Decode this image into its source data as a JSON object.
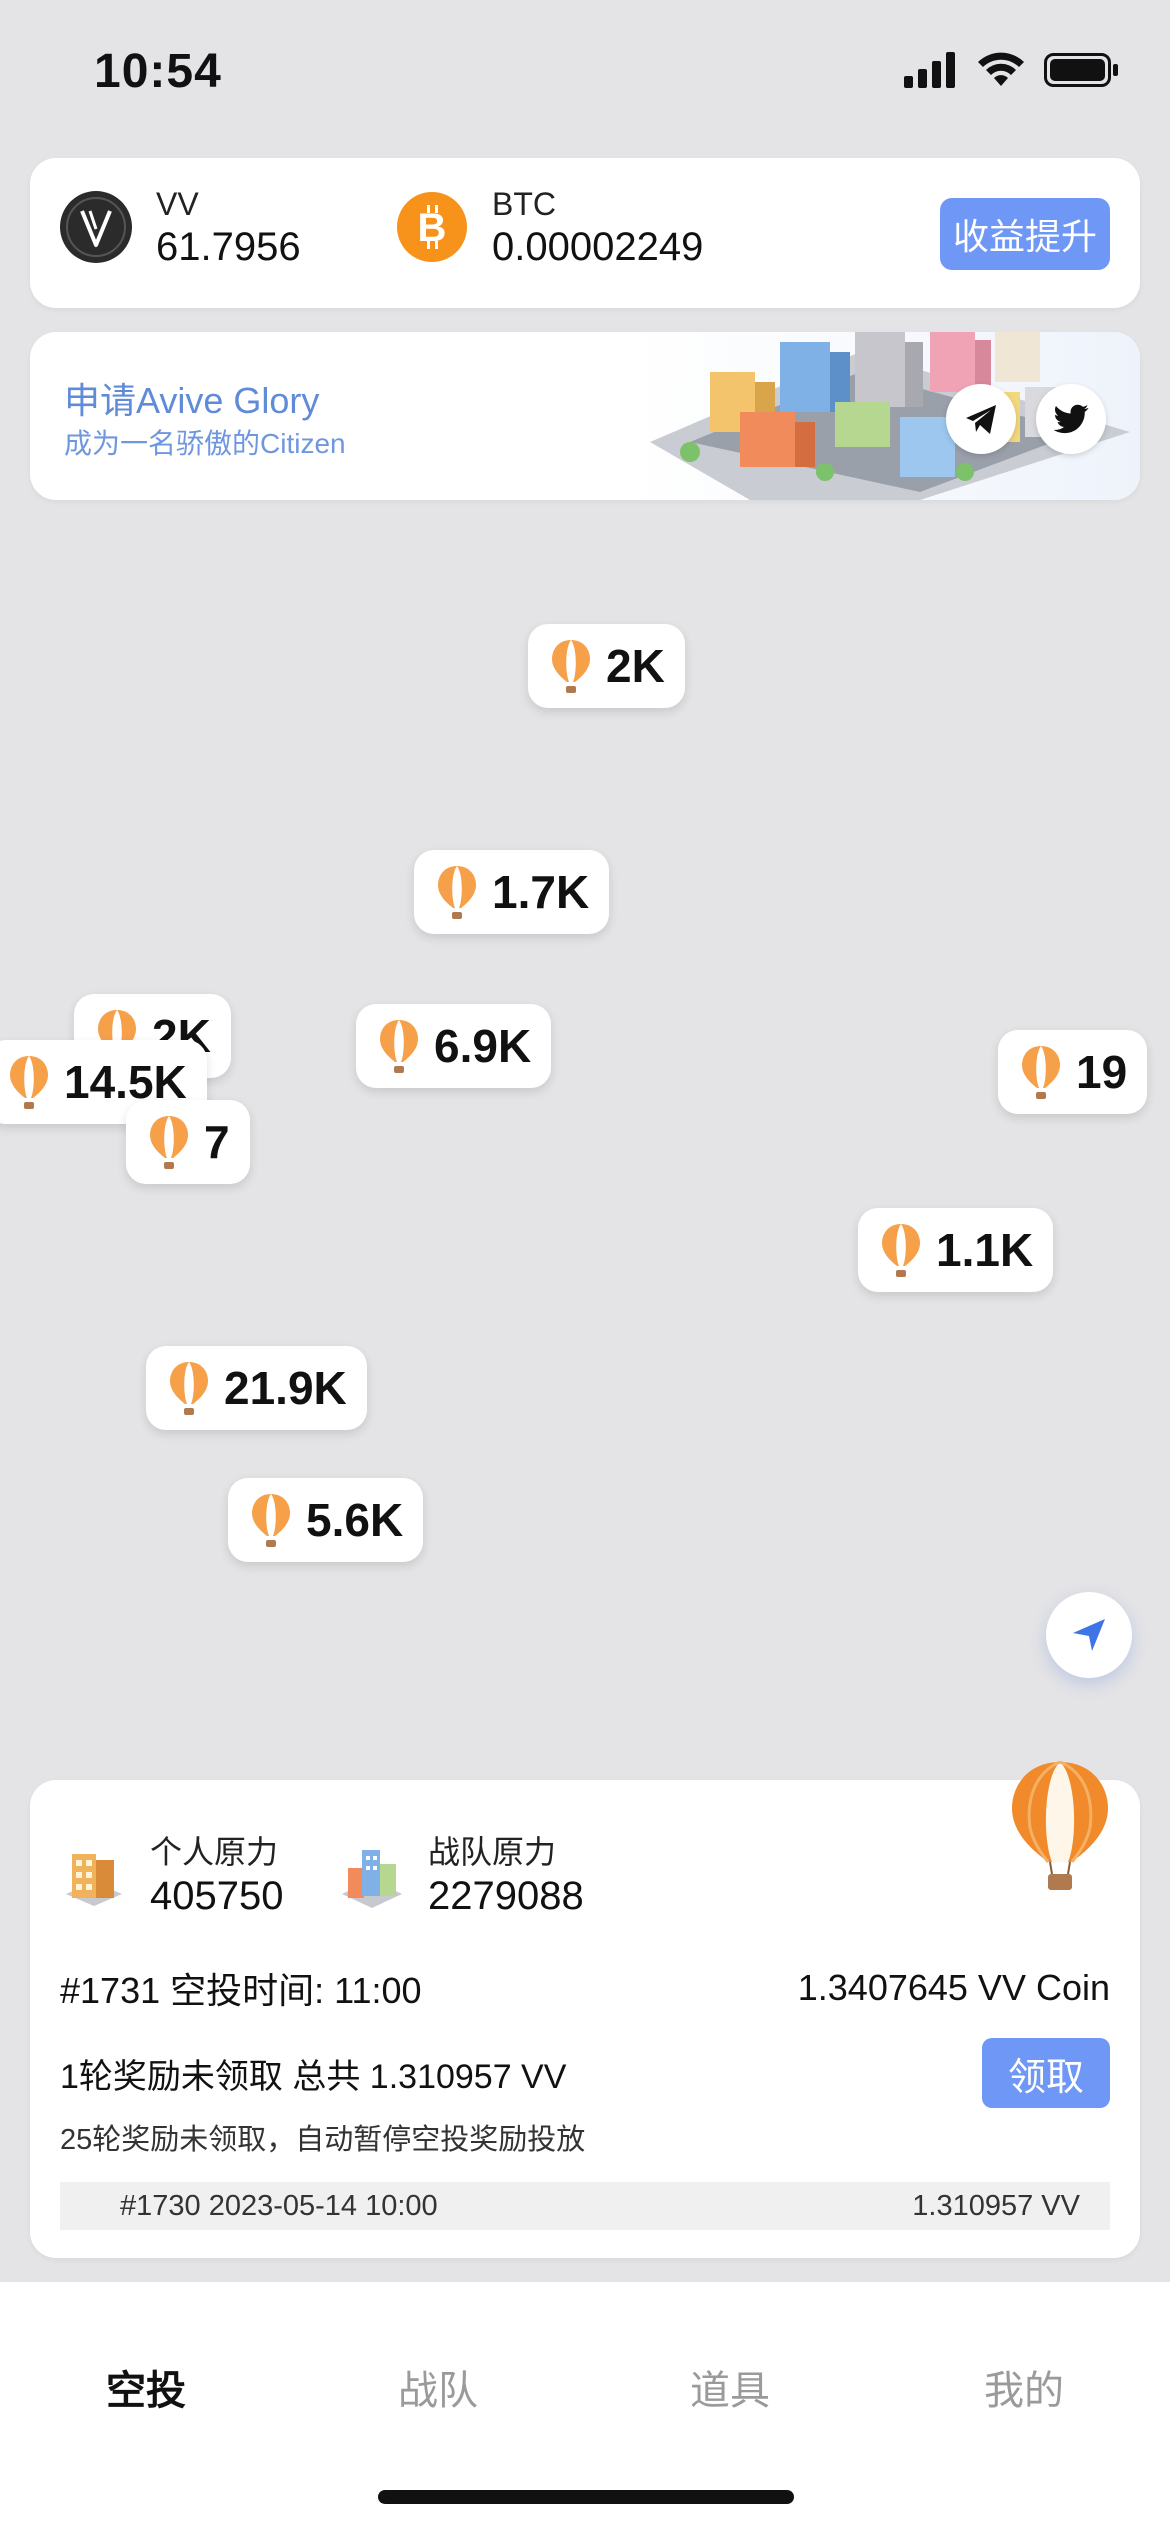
{
  "status_bar": {
    "time": "10:54"
  },
  "wallet": {
    "coins": [
      {
        "name": "VV",
        "amount": "61.7956"
      },
      {
        "name": "BTC",
        "amount": "0.00002249"
      }
    ],
    "boost_label": "收益提升"
  },
  "banner": {
    "title": "申请Avive Glory",
    "subtitle": "成为一名骄傲的Citizen"
  },
  "map": {
    "balloons": [
      "2K",
      "1.7K",
      "2K",
      "6.9K",
      "14.5K",
      "7",
      "19",
      "1.1K",
      "21.9K",
      "5.6K"
    ]
  },
  "panel": {
    "personal_label": "个人原力",
    "personal_value": "405750",
    "team_label": "战队原力",
    "team_value": "2279088",
    "airdrop_info": "#1731 空投时间: 11:00",
    "airdrop_amount": "1.3407645 VV Coin",
    "unclaimed": "1轮奖励未领取 总共 1.310957 VV",
    "claim_label": "领取",
    "warning": "25轮奖励未领取，自动暂停空投奖励投放",
    "history_entry": "#1730 2023-05-14 10:00",
    "history_amount": "1.310957 VV"
  },
  "tabs": [
    "空投",
    "战队",
    "道具",
    "我的"
  ],
  "colors": {
    "accent": "#6f97f5",
    "background": "#e4e4e6",
    "balloon_orange": "#f08a2a"
  }
}
